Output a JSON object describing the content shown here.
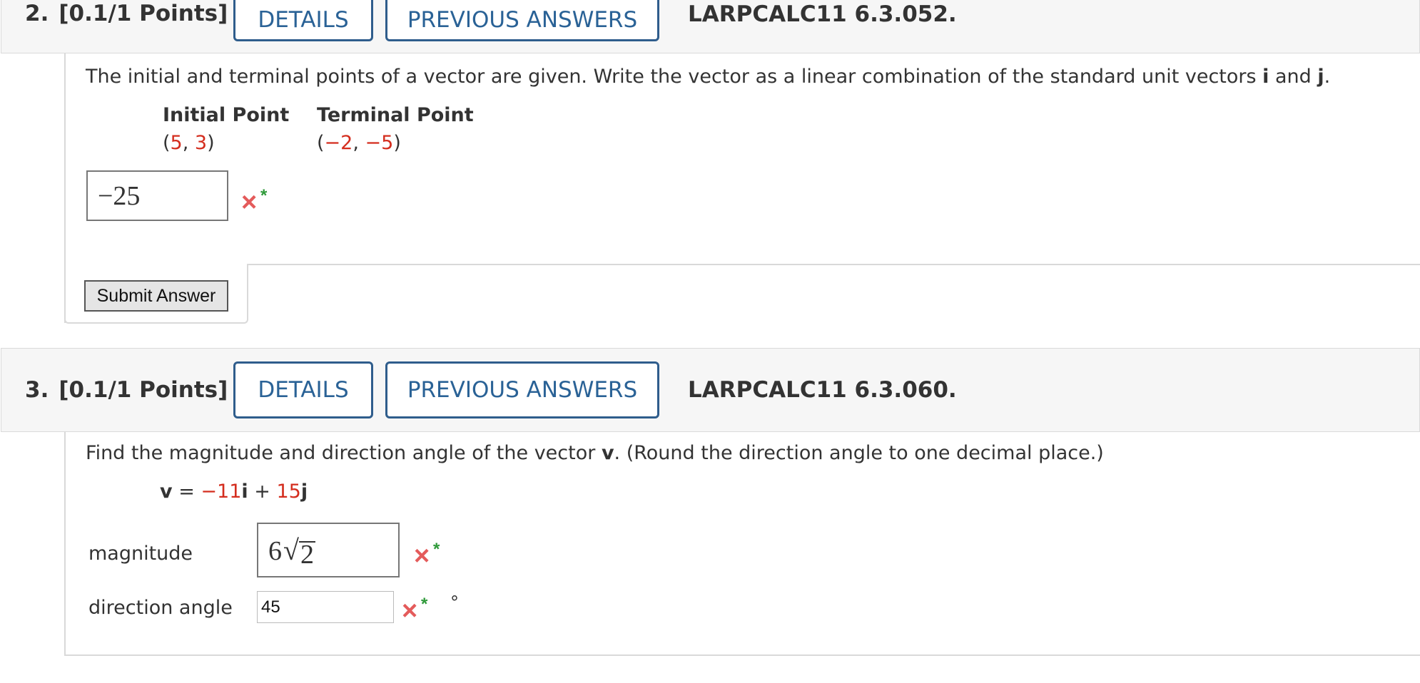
{
  "q2": {
    "number": "2.",
    "points": "[0.1/1 Points]",
    "details_label": "DETAILS",
    "prev_answers_label": "PREVIOUS ANSWERS",
    "code": "LARPCALC11 6.3.052.",
    "prompt_part1": "The initial and terminal points of a vector are given. Write the vector as a linear combination of the standard unit vectors ",
    "prompt_i": "i",
    "prompt_and": " and ",
    "prompt_j": "j",
    "prompt_end": ".",
    "initial_header": "Initial Point",
    "terminal_header": "Terminal Point",
    "initial_x": "5",
    "initial_y": "3",
    "terminal_x": "−2",
    "terminal_y": "−5",
    "answer_value": "−25",
    "submit_label": "Submit Answer"
  },
  "q3": {
    "number": "3.",
    "points": "[0.1/1 Points]",
    "details_label": "DETAILS",
    "prev_answers_label": "PREVIOUS ANSWERS",
    "code": "LARPCALC11 6.3.060.",
    "prompt_part1": "Find the magnitude and direction angle of the vector ",
    "prompt_v": "v",
    "prompt_part2": ". (Round the direction angle to one decimal place.)",
    "eq_v": "v",
    "eq_equals": " = ",
    "eq_a": "−11",
    "eq_i": "i",
    "eq_plus": " + ",
    "eq_b": "15",
    "eq_j": "j",
    "magnitude_label": "magnitude",
    "magnitude_coef": "6",
    "magnitude_radicand": "2",
    "direction_label": "direction angle",
    "direction_value": "45",
    "degree_symbol": "°"
  },
  "icons": {
    "incorrect_mark": "×",
    "star": "*"
  },
  "colors": {
    "link_blue": "#2a6296",
    "red_value": "#d42d1e",
    "incorrect_red": "#e45b5b",
    "star_green": "#2f9a3a"
  }
}
